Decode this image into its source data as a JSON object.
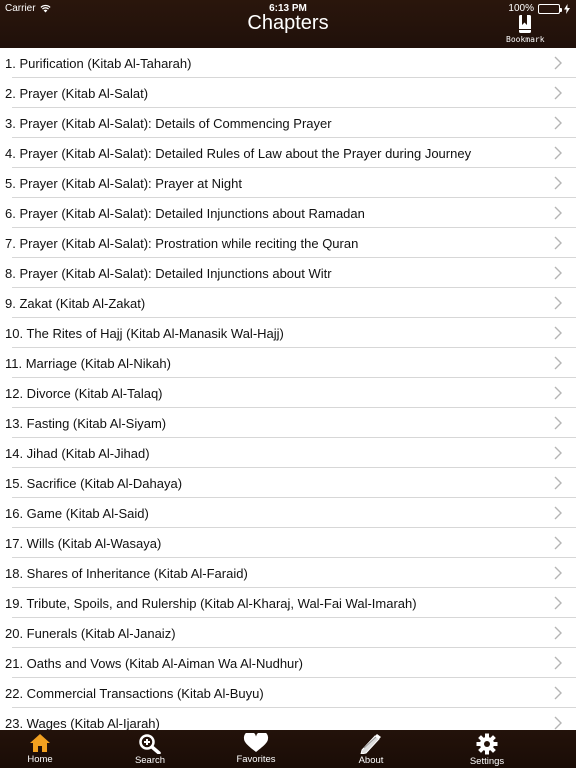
{
  "status_bar": {
    "carrier": "Carrier",
    "time": "6:13 PM",
    "battery": "100%",
    "battery_color": "#4cd964"
  },
  "header": {
    "title": "Chapters",
    "bookmark_label": "Bookmark",
    "background": "#241209"
  },
  "chapters": [
    "1. Purification (Kitab Al-Taharah)",
    "2. Prayer (Kitab Al-Salat)",
    "3. Prayer (Kitab Al-Salat): Details of Commencing Prayer",
    "4. Prayer (Kitab Al-Salat): Detailed Rules of Law about the Prayer during Journey",
    "5. Prayer (Kitab Al-Salat): Prayer at Night",
    "6. Prayer (Kitab Al-Salat): Detailed Injunctions about Ramadan",
    "7. Prayer (Kitab Al-Salat): Prostration while reciting the Quran",
    "8. Prayer (Kitab Al-Salat): Detailed Injunctions about Witr",
    "9. Zakat (Kitab Al-Zakat)",
    "10. The Rites of Hajj (Kitab Al-Manasik Wal-Hajj)",
    "11. Marriage (Kitab Al-Nikah)",
    "12. Divorce (Kitab Al-Talaq)",
    "13. Fasting (Kitab Al-Siyam)",
    "14. Jihad (Kitab Al-Jihad)",
    "15. Sacrifice (Kitab Al-Dahaya)",
    "16. Game (Kitab Al-Said)",
    "17. Wills (Kitab Al-Wasaya)",
    "18. Shares of Inheritance (Kitab Al-Faraid)",
    "19. Tribute, Spoils, and Rulership (Kitab Al-Kharaj, Wal-Fai Wal-Imarah)",
    "20. Funerals (Kitab Al-Janaiz)",
    "21. Oaths and Vows (Kitab Al-Aiman Wa Al-Nudhur)",
    "22. Commercial Transactions (Kitab Al-Buyu)",
    "23. Wages (Kitab Al-Ijarah)"
  ],
  "tabbar": {
    "tabs": [
      {
        "label": "Home",
        "icon": "home-icon",
        "active": true
      },
      {
        "label": "Search",
        "icon": "search-icon",
        "active": false
      },
      {
        "label": "Favorites",
        "icon": "heart-icon",
        "active": false
      },
      {
        "label": "About",
        "icon": "pencil-icon",
        "active": false
      },
      {
        "label": "Settings",
        "icon": "gear-icon",
        "active": false
      }
    ],
    "active_color": "#f0a020"
  }
}
